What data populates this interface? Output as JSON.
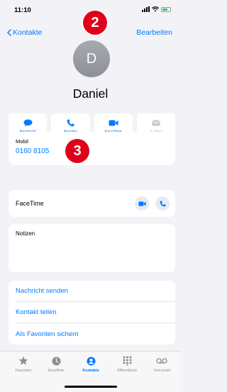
{
  "status_bar": {
    "time": "11:10",
    "battery_color": "#34c759"
  },
  "nav": {
    "back_label": "Kontakte",
    "edit_label": "Bearbeiten"
  },
  "badges": {
    "first": "2",
    "second": "3"
  },
  "contact": {
    "initial": "D",
    "name": "Daniel"
  },
  "actions": [
    {
      "label": "Nachricht",
      "icon": "message-icon",
      "enabled": true
    },
    {
      "label": "Anrufen",
      "icon": "phone-icon",
      "enabled": true
    },
    {
      "label": "FaceTime",
      "icon": "video-icon",
      "enabled": true
    },
    {
      "label": "E-Mail",
      "icon": "mail-icon",
      "enabled": false
    }
  ],
  "mobile": {
    "label": "Mobil",
    "number": "0160 8105"
  },
  "facetime": {
    "label": "FaceTime"
  },
  "notes": {
    "label": "Notizen"
  },
  "links": [
    "Nachricht senden",
    "Kontakt teilen",
    "Als Favoriten sichern"
  ],
  "tabs": [
    {
      "label": "Favoriten",
      "icon": "star-icon",
      "active": false
    },
    {
      "label": "Anrufliste",
      "icon": "clock-icon",
      "active": false
    },
    {
      "label": "Kontakte",
      "icon": "person-icon",
      "active": true
    },
    {
      "label": "Ziffernblock",
      "icon": "keypad-icon",
      "active": false
    },
    {
      "label": "Voicemail",
      "icon": "voicemail-icon",
      "active": false
    }
  ],
  "colors": {
    "accent": "#007aff",
    "badge": "#e0001b",
    "background": "#f2f2f7"
  }
}
